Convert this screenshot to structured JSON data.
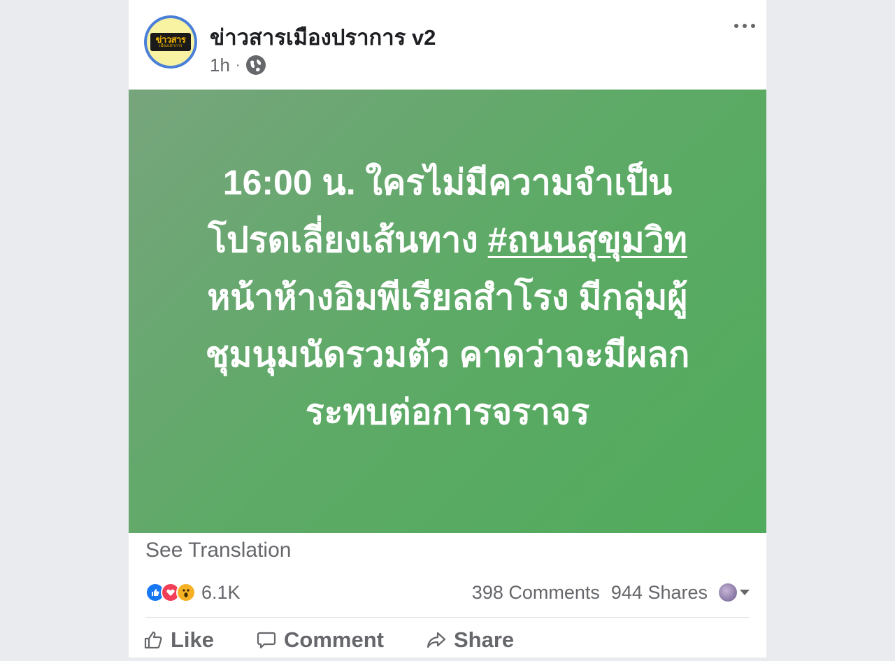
{
  "post": {
    "page_name": "ข่าวสารเมืองปราการ v2",
    "timestamp": "1h",
    "separator": "·",
    "privacy_icon": "globe-icon",
    "avatar_text": "ข่าวสาร",
    "avatar_subtext": "เมืองปราการ",
    "image_text": {
      "line1": "16:00 น. ใครไม่มีความจำเป็น",
      "line2_prefix": "โปรดเลี่ยงเส้นทาง ",
      "line2_hashtag": "#ถนนสุขุมวิท",
      "line3": "หน้าห้างอิมพีเรียลสำโรง มีกลุ่มผู้",
      "line4": "ชุมนุมนัดรวมตัว คาดว่าจะมีผลก",
      "line5": "ระทบต่อการจราจร"
    },
    "image_background": "#5daa66",
    "see_translation": "See Translation"
  },
  "engagement": {
    "reaction_icons": [
      "like-icon",
      "love-icon",
      "wow-icon"
    ],
    "reaction_count": "6.1K",
    "comments": "398 Comments",
    "shares": "944 Shares"
  },
  "actions": {
    "like": "Like",
    "comment": "Comment",
    "share": "Share"
  },
  "colors": {
    "text_primary": "#1c1e21",
    "text_secondary": "#65676b",
    "like_blue": "#1877f2",
    "love_red": "#f33e58",
    "wow_yellow": "#f7b125"
  }
}
